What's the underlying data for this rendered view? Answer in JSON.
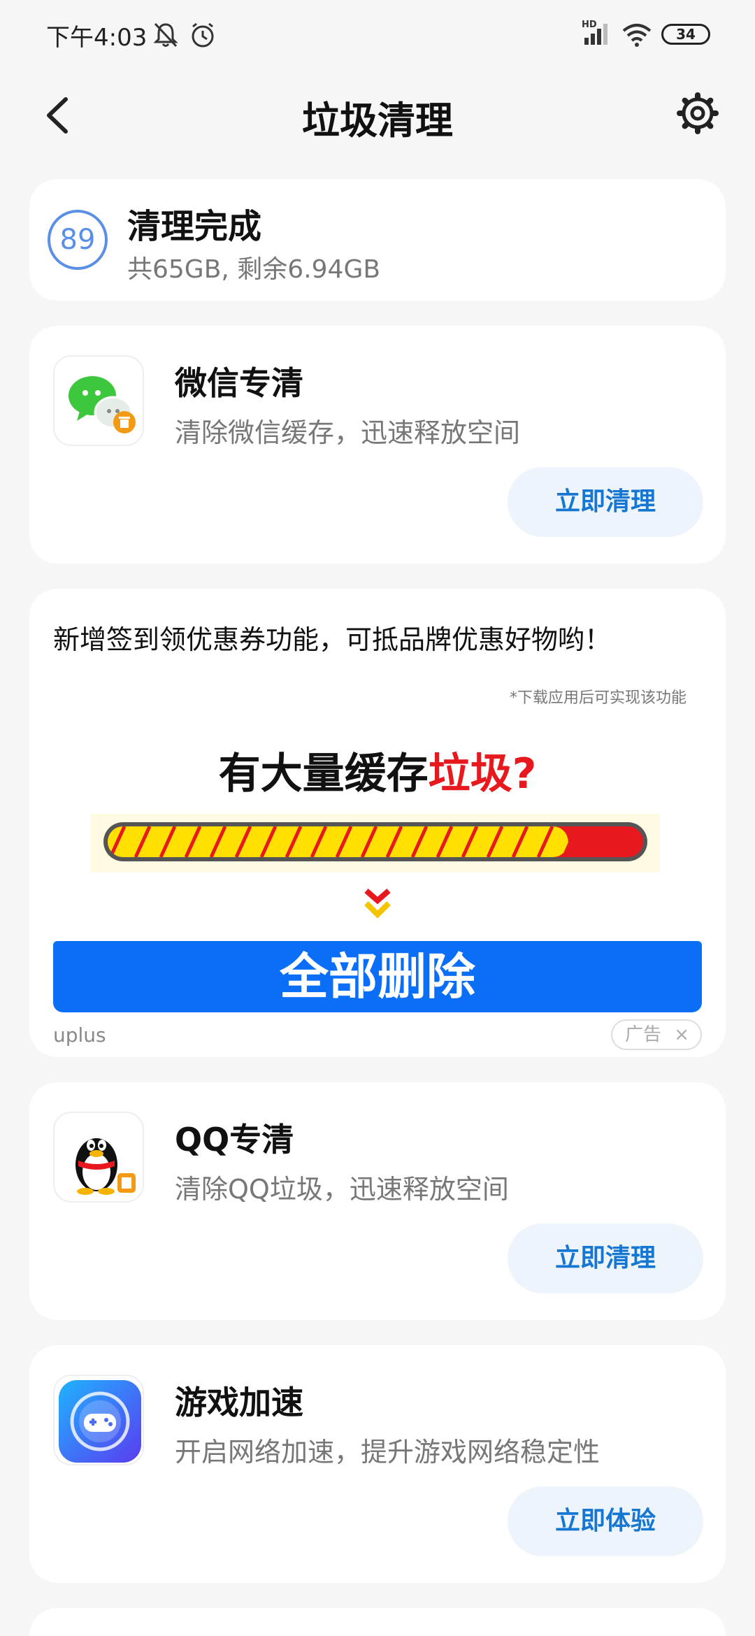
{
  "status_bar": {
    "time": "下午4:03",
    "hd_label": "HD",
    "battery": "34"
  },
  "header": {
    "title": "垃圾清理"
  },
  "summary": {
    "score": "89",
    "title": "清理完成",
    "subtitle": "共65GB, 剩余6.94GB"
  },
  "features": [
    {
      "title": "微信专清",
      "desc": "清除微信缓存，迅速释放空间",
      "button": "立即清理",
      "icon": "wechat-clean-icon"
    },
    {
      "title": "QQ专清",
      "desc": "清除QQ垃圾，迅速释放空间",
      "button": "立即清理",
      "icon": "qq-clean-icon"
    },
    {
      "title": "游戏加速",
      "desc": "开启网络加速，提升游戏网络稳定性",
      "button": "立即体验",
      "icon": "game-boost-icon"
    }
  ],
  "ad": {
    "headline": "新增签到领优惠券功能，可抵品牌优惠好物哟！",
    "note": "*下载应用后可实现该功能",
    "big_text_black": "有大量缓存",
    "big_text_red": "垃圾?",
    "cta": "全部删除",
    "source": "uplus",
    "tag": "广告",
    "close": "×",
    "progress_fraction": 0.86
  },
  "colors": {
    "accent": "#1677d2",
    "cta_blue": "#0a6ef7",
    "warn_red": "#e8191e",
    "score_blue": "#5a8fe8"
  }
}
